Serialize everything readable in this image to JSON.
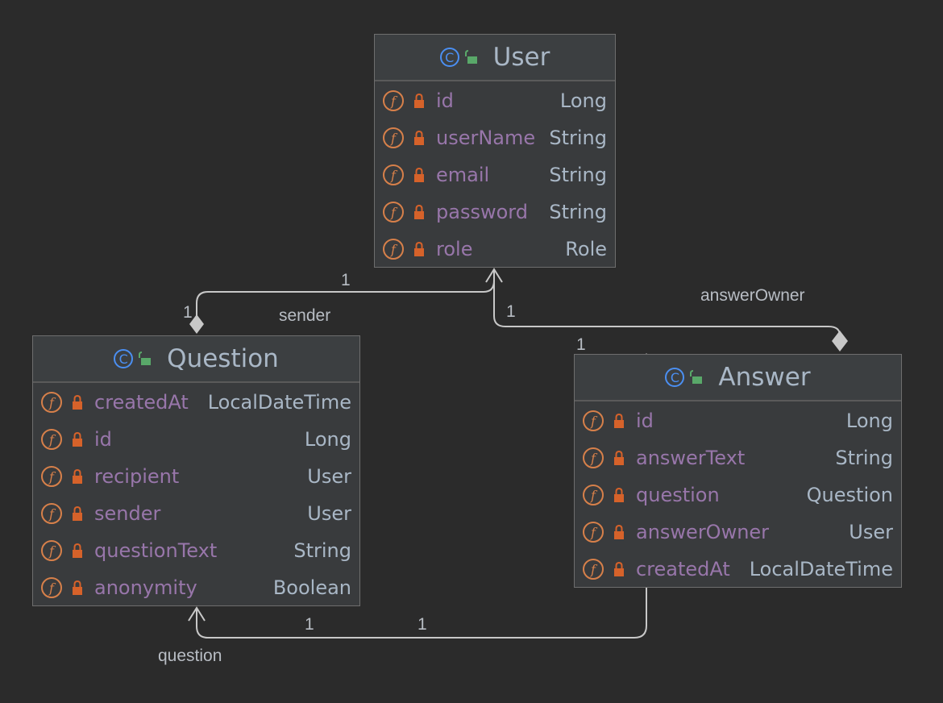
{
  "classes": {
    "user": {
      "name": "User",
      "fields": [
        {
          "name": "id",
          "type": "Long"
        },
        {
          "name": "userName",
          "type": "String"
        },
        {
          "name": "email",
          "type": "String"
        },
        {
          "name": "password",
          "type": "String"
        },
        {
          "name": "role",
          "type": "Role"
        }
      ]
    },
    "question": {
      "name": "Question",
      "fields": [
        {
          "name": "createdAt",
          "type": "LocalDateTime"
        },
        {
          "name": "id",
          "type": "Long"
        },
        {
          "name": "recipient",
          "type": "User"
        },
        {
          "name": "sender",
          "type": "User"
        },
        {
          "name": "questionText",
          "type": "String"
        },
        {
          "name": "anonymity",
          "type": "Boolean"
        }
      ]
    },
    "answer": {
      "name": "Answer",
      "fields": [
        {
          "name": "id",
          "type": "Long"
        },
        {
          "name": "answerText",
          "type": "String"
        },
        {
          "name": "question",
          "type": "Question"
        },
        {
          "name": "answerOwner",
          "type": "User"
        },
        {
          "name": "createdAt",
          "type": "LocalDateTime"
        }
      ]
    }
  },
  "edges": {
    "sender": {
      "label": "sender",
      "mult_user": "1",
      "mult_source": "1"
    },
    "answer_owner": {
      "label": "answerOwner",
      "mult_user": "1",
      "mult_source": "1"
    },
    "question": {
      "label": "question",
      "mult_question": "1",
      "mult_source": "1"
    }
  },
  "icons": {
    "class": "class-icon",
    "field": "field-icon",
    "public": "unlocked-icon",
    "private": "lock-icon"
  },
  "colors": {
    "background": "#2b2b2b",
    "class_icon": "#4b8ff2",
    "field_icon": "#d7804a",
    "field_name": "#9876aa",
    "type_text": "#a9b7c6",
    "edge": "#c8c8c8"
  }
}
